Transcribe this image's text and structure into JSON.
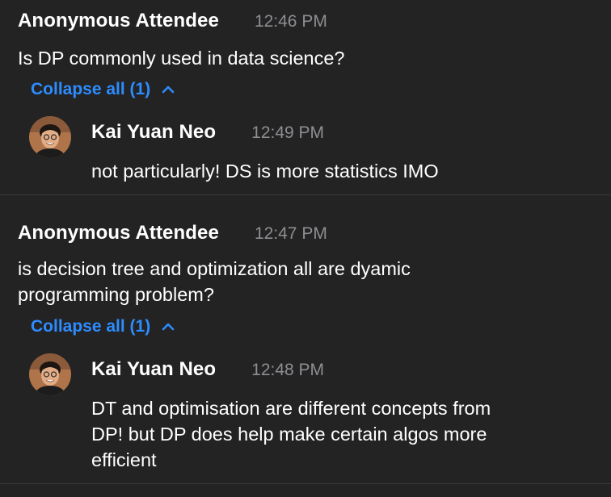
{
  "threads": [
    {
      "question": {
        "sender": "Anonymous Attendee",
        "time": "12:46 PM",
        "text": "Is DP commonly used in data science?"
      },
      "collapse_label": "Collapse all (1)",
      "reply": {
        "sender": "Kai Yuan Neo",
        "time": "12:49 PM",
        "text": "not particularly! DS is more statistics IMO"
      }
    },
    {
      "question": {
        "sender": "Anonymous Attendee",
        "time": "12:47 PM",
        "text": "is decision tree and optimization all are dyamic\nprogramming problem?"
      },
      "collapse_label": "Collapse all (1)",
      "reply": {
        "sender": "Kai Yuan Neo",
        "time": "12:48 PM",
        "text": "DT and optimisation are different concepts from\nDP! but DP does help make certain algos more\nefficient"
      }
    }
  ],
  "colors": {
    "background": "#232323",
    "link": "#2d8cff",
    "timestamp": "#8e8e93",
    "divider": "#393939"
  },
  "icons": {
    "collapse": "chevron-up-icon",
    "avatar": "user-avatar"
  }
}
